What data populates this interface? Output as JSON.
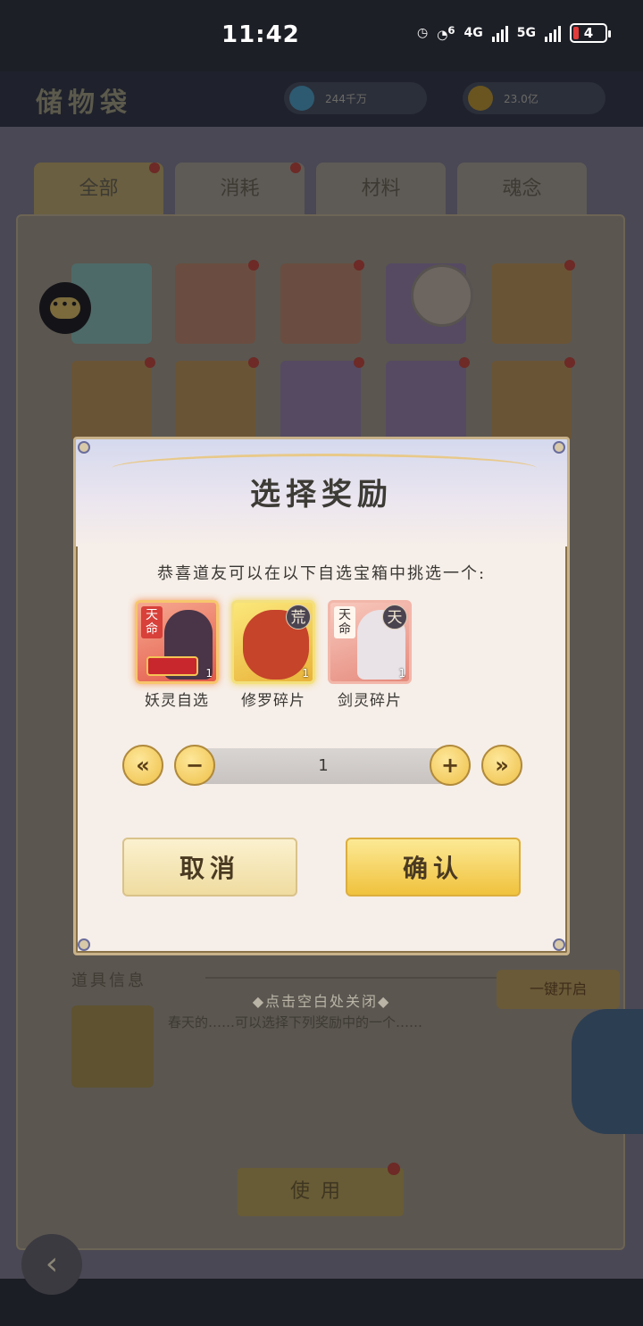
{
  "status_bar": {
    "time": "11:42",
    "net_4g": "4G",
    "net_5g": "5G",
    "wifi_badge": "6",
    "battery": "4"
  },
  "background": {
    "title": "储物袋",
    "resource1": "244千万",
    "resource2": "23.0亿",
    "tabs": [
      "全部",
      "消耗",
      "材料",
      "魂念"
    ],
    "info_title": "道具信息",
    "info_text": "春天的……可以选择下列奖励中的一个……",
    "unlock_button": "一键开启",
    "use_button": "使用"
  },
  "dialog": {
    "title": "选择奖励",
    "prompt": "恭喜道友可以在以下自选宝箱中挑选一个:",
    "rewards": [
      {
        "label": "妖灵自选",
        "tag": "天命",
        "rank": "",
        "qty": "1"
      },
      {
        "label": "修罗碎片",
        "tag": "",
        "rank": "荒",
        "qty": "1"
      },
      {
        "label": "剑灵碎片",
        "tag": "天命",
        "rank": "天",
        "qty": "1"
      }
    ],
    "stepper": {
      "first": "«",
      "minus": "−",
      "value": "1",
      "plus": "+",
      "last": "»"
    },
    "cancel_label": "取消",
    "confirm_label": "确认"
  },
  "close_hint": "◆点击空白处关闭◆"
}
